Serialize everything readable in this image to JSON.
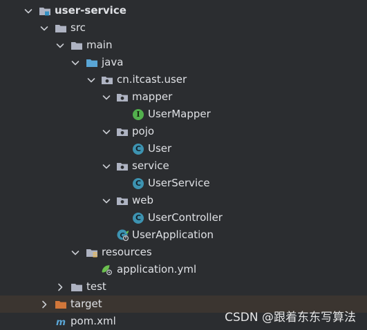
{
  "project_tree": {
    "root": "user-service",
    "src": "src",
    "main": "main",
    "java": "java",
    "package": "cn.itcast.user",
    "mapper_pkg": "mapper",
    "user_mapper": "UserMapper",
    "pojo_pkg": "pojo",
    "user_class": "User",
    "service_pkg": "service",
    "user_service": "UserService",
    "web_pkg": "web",
    "user_controller": "UserController",
    "user_application": "UserApplication",
    "resources": "resources",
    "application_yml": "application.yml",
    "test": "test",
    "target": "target",
    "pom": "pom.xml"
  },
  "icons": {
    "class_letter": "C",
    "interface_letter": "I"
  },
  "watermark": "CSDN @跟着东东写算法",
  "colors": {
    "background": "#2b2d30",
    "text": "#dfe1e5",
    "folder": "#aeb3c2",
    "source_folder": "#5aa6d6",
    "excluded_folder": "#d2773a",
    "class_icon": "#3d93b1",
    "interface_icon": "#52b04d",
    "highlight_row": "#3b3530"
  }
}
